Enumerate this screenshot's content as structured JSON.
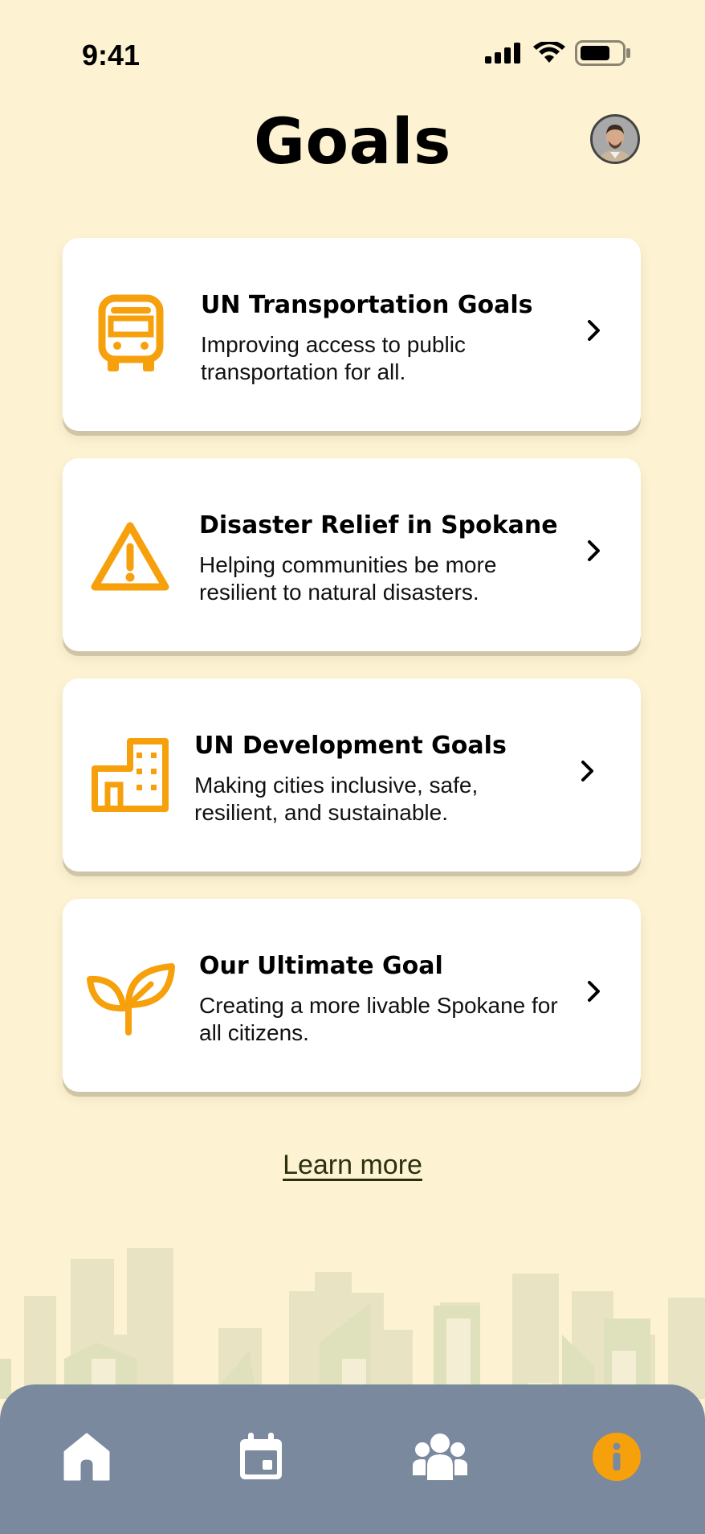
{
  "status": {
    "time": "9:41"
  },
  "header": {
    "title": "Goals"
  },
  "colors": {
    "accent": "#f6a10c",
    "background": "#fdf3d2",
    "nav": "#7a899e"
  },
  "goals": [
    {
      "icon": "bus-icon",
      "title": "UN Transportation Goals",
      "description": "Improving access to public transportation for all."
    },
    {
      "icon": "warning-icon",
      "title": "Disaster Relief in Spokane",
      "description": "Helping communities be more resilient to natural disasters."
    },
    {
      "icon": "building-icon",
      "title": "UN Development Goals",
      "description": "Making cities inclusive, safe, resilient, and sustainable."
    },
    {
      "icon": "sprout-icon",
      "title": "Our Ultimate Goal",
      "description": "Creating a more livable Spokane for all citizens."
    }
  ],
  "learn_more": "Learn more",
  "nav": [
    {
      "icon": "home-icon",
      "active": false
    },
    {
      "icon": "calendar-icon",
      "active": false
    },
    {
      "icon": "community-icon",
      "active": false
    },
    {
      "icon": "info-icon",
      "active": true
    }
  ]
}
